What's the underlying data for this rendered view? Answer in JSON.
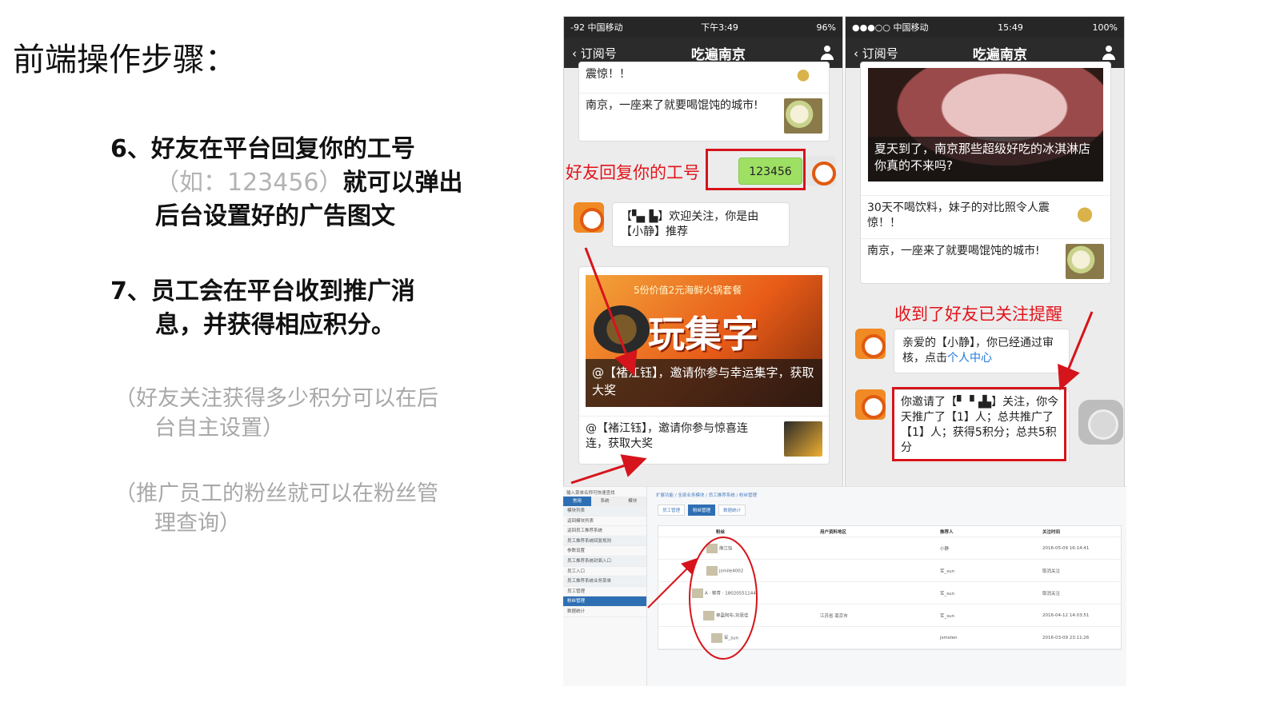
{
  "slide": {
    "title": "前端操作步骤：",
    "step6": {
      "line1": "6、好友在平台回复你的工号",
      "line2_light": "（如：123456）",
      "line2_bold": "就可以弹出",
      "line3": "后台设置好的广告图文"
    },
    "step7": {
      "line1": "7、员工会在平台收到推广消",
      "line2": "息，并获得相应积分。"
    },
    "note1": {
      "line1": "（好友关注获得多少积分可以在后",
      "line2": "台自主设置）"
    },
    "note2": {
      "line1": "（推广员工的粉丝就可以在粉丝管",
      "line2": "理查询）"
    }
  },
  "phone_left": {
    "status": {
      "carrier": "-92 中国移动",
      "time": "下午3:49",
      "battery": "96%"
    },
    "nav": {
      "back": "订阅号",
      "title": "吃遍南京"
    },
    "article_top": {
      "item1": "震惊！！",
      "item2": "南京，一座来了就要喝馄饨的城市!"
    },
    "reply_code": "123456",
    "annotation_reply": "好友回复你的工号",
    "welcome_msg": "【▚▖▙】欢迎关注，你是由【小静】推荐",
    "promo": {
      "banner_small": "5份价值2元海鲜火锅套餐",
      "banner_big": "玩集字",
      "caption": "@【褚江钰】，邀请你参与幸运集字，获取大奖",
      "item2": "@【褚江钰】，邀请你参与惊喜连连，获取大奖"
    }
  },
  "phone_right": {
    "status": {
      "carrier": "●●●○○ 中国移动",
      "time": "15:49",
      "battery": "100%"
    },
    "nav": {
      "back": "订阅号",
      "title": "吃遍南京"
    },
    "article": {
      "caption": "夏天到了，南京那些超级好吃的冰淇淋店你真的不来吗?",
      "item1": "30天不喝饮料，妹子的对比照令人震惊！！",
      "item2": "南京，一座来了就要喝馄饨的城市!"
    },
    "annotation_notice": "收到了好友已关注提醒",
    "msg_verified": {
      "text": "亲爱的【小静】，你已经通过审核，点击",
      "link": "个人中心"
    },
    "msg_invite": "你邀请了【▘▝▗▙】关注，你今天推广了【1】人；总共推广了【1】人；获得5积分；总共5积分"
  },
  "admin": {
    "side_title": "输入菜单名称可快速查找",
    "side_tabs": [
      "常用",
      "系统",
      "模块"
    ],
    "side_items": [
      {
        "label": "模块列表",
        "group": true
      },
      {
        "label": "返回模块列表"
      },
      {
        "label": "返回员工推荐系统"
      },
      {
        "label": "员工推荐系统回复规则",
        "group": true
      },
      {
        "label": "参数设置"
      },
      {
        "label": "员工推荐系统封面入口",
        "group": true
      },
      {
        "label": "员工入口"
      },
      {
        "label": "员工推荐系统业务菜单",
        "group": true
      },
      {
        "label": "员工管理"
      },
      {
        "label": "粉丝管理",
        "active": true
      },
      {
        "label": "数据统计"
      }
    ],
    "breadcrumb": "扩展功能 / 全部业务模块 / 员工推荐系统 / 粉丝管理",
    "subtabs": [
      "员工管理",
      "粉丝管理",
      "数据统计"
    ],
    "columns": [
      "粉丝",
      "用户资料地区",
      "推荐人",
      "关注时间"
    ],
    "rows": [
      {
        "fan": "南江钰",
        "region": "",
        "referrer": "小静",
        "time": "2016-05-09 16:14:41"
      },
      {
        "fan": "jsmile4002",
        "region": "",
        "referrer": "军_sun",
        "time": "取消关注"
      },
      {
        "fan": "A · 郁青 · 18020551144",
        "region": "",
        "referrer": "军_sun",
        "time": "取消关注"
      },
      {
        "fan": "单盈阿布-刘思佳",
        "region": "江苏省 南京市",
        "referrer": "军_sun",
        "time": "2016-04-12 14:03:51"
      },
      {
        "fan": "军_sun",
        "region": "",
        "referrer": "jsmsten",
        "time": "2016-03-09 23:11:26"
      }
    ]
  },
  "colors": {
    "accent_red": "#e3141b",
    "wechat_green": "#9ee063",
    "admin_blue": "#2e6fb4"
  }
}
